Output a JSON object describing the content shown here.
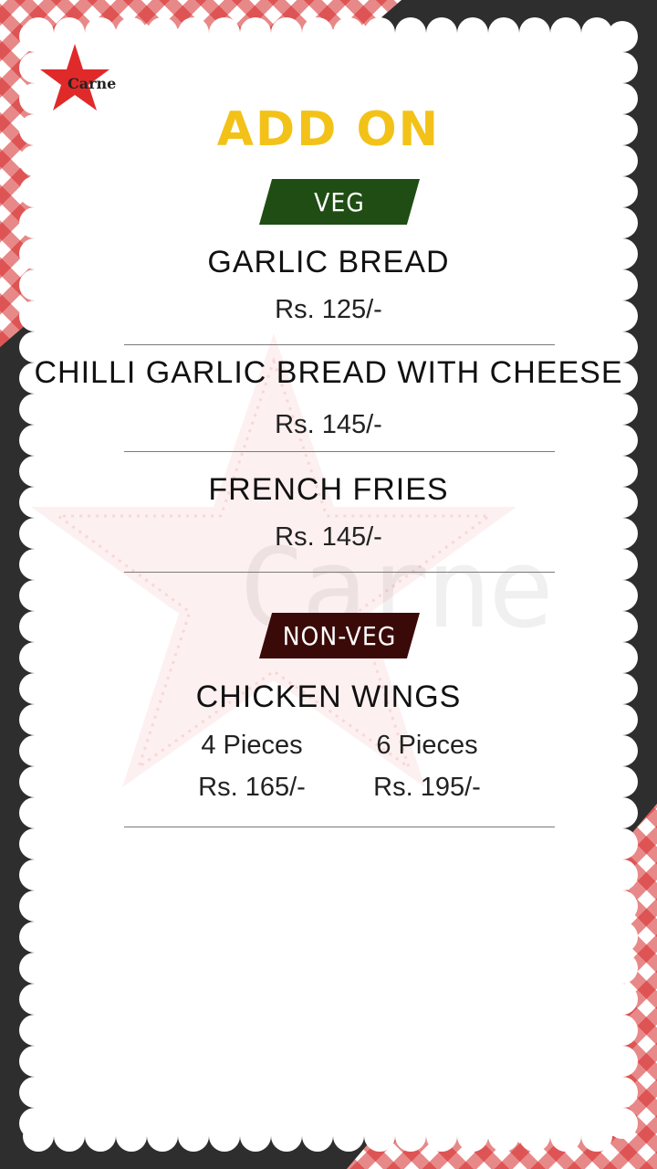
{
  "brand": {
    "logo_text": "Carne",
    "watermark_text": "Carne"
  },
  "title": "ADD ON",
  "sections": {
    "veg": {
      "label": "VEG",
      "items": [
        {
          "name": "GARLIC BREAD",
          "price": "Rs. 125/-"
        },
        {
          "name": "CHILLI GARLIC BREAD WITH CHEESE",
          "price": "Rs. 145/-"
        },
        {
          "name": "FRENCH FRIES",
          "price": "Rs. 145/-"
        }
      ]
    },
    "nonveg": {
      "label": "NON-VEG",
      "items": [
        {
          "name": "CHICKEN WINGS",
          "options": [
            {
              "label": "4 Pieces",
              "price": "Rs. 165/-"
            },
            {
              "label": "6 Pieces",
              "price": "Rs. 195/-"
            }
          ]
        }
      ]
    }
  },
  "colors": {
    "title": "#f3c218",
    "veg_banner": "#1f4d14",
    "nonveg_banner": "#3a0a08",
    "star": "#e02a2a",
    "background_dark": "#2e2e2e"
  },
  "icons": [
    "star-icon"
  ]
}
